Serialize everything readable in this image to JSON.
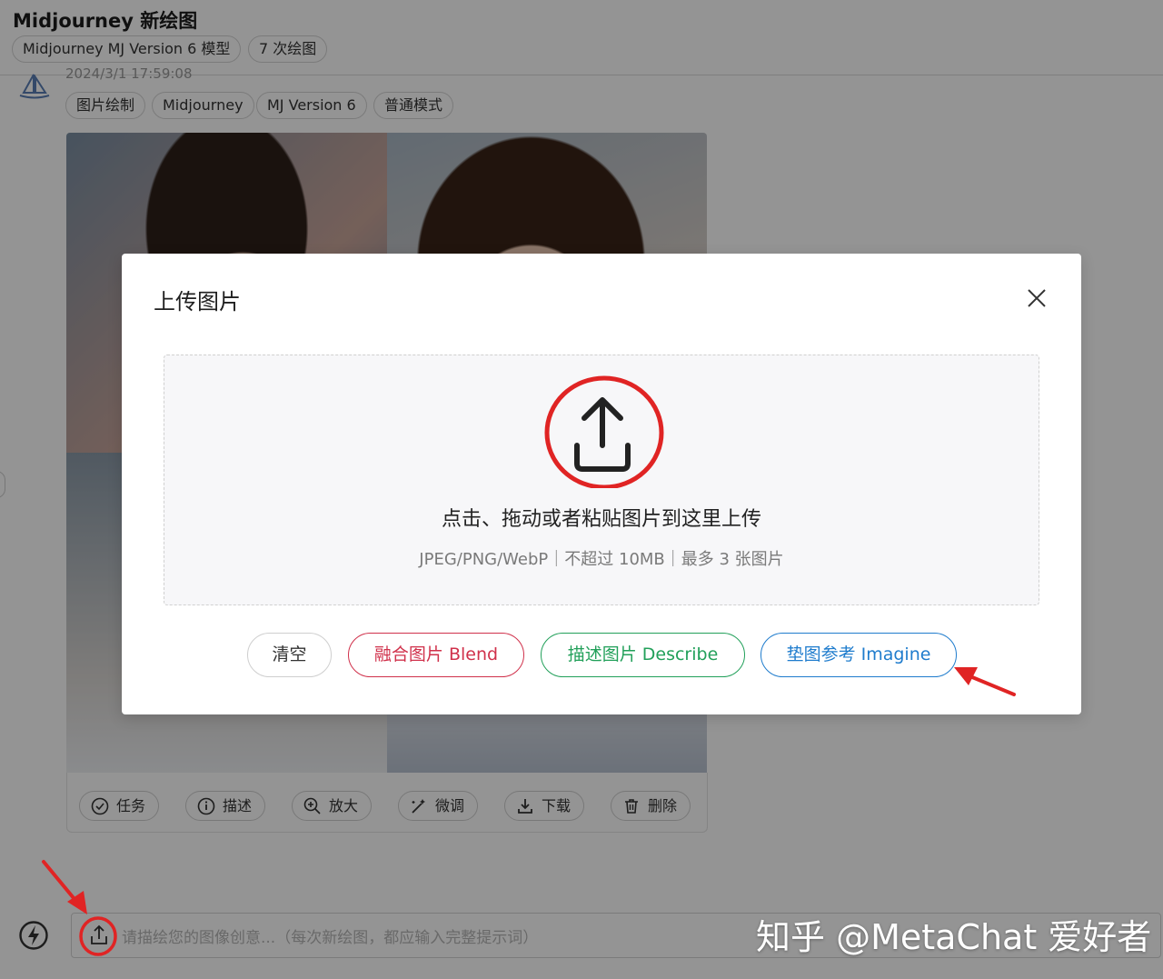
{
  "header": {
    "title": "Midjourney 新绘图",
    "chips": [
      "Midjourney MJ Version 6 模型",
      "7 次绘图"
    ]
  },
  "message": {
    "time": "2024/3/1 17:59:08",
    "tags": [
      "图片绘制",
      "Midjourney",
      "MJ Version 6",
      "普通模式"
    ],
    "actions": [
      {
        "label": "任务",
        "icon": "check-circle-icon"
      },
      {
        "label": "描述",
        "icon": "info-circle-icon"
      },
      {
        "label": "放大",
        "icon": "zoom-in-icon"
      },
      {
        "label": "微调",
        "icon": "magic-wand-icon"
      },
      {
        "label": "下载",
        "icon": "download-icon"
      },
      {
        "label": "删除",
        "icon": "trash-icon"
      }
    ]
  },
  "modal": {
    "title": "上传图片",
    "drop_main": "点击、拖动或者粘贴图片到这里上传",
    "drop_sub": "JPEG/PNG/WebP｜不超过 10MB｜最多 3 张图片",
    "buttons": {
      "clear": "清空",
      "blend": "融合图片 Blend",
      "describe": "描述图片 Describe",
      "imagine": "垫图参考 Imagine"
    },
    "colors": {
      "blend": "#d0314b",
      "describe": "#22a05a",
      "imagine": "#1f7ccd",
      "annotation": "#e02424"
    }
  },
  "prompt": {
    "placeholder": "请描绘您的图像创意...（每次新绘图，都应输入完整提示词）"
  },
  "watermark": "知乎 @MetaChat 爱好者"
}
